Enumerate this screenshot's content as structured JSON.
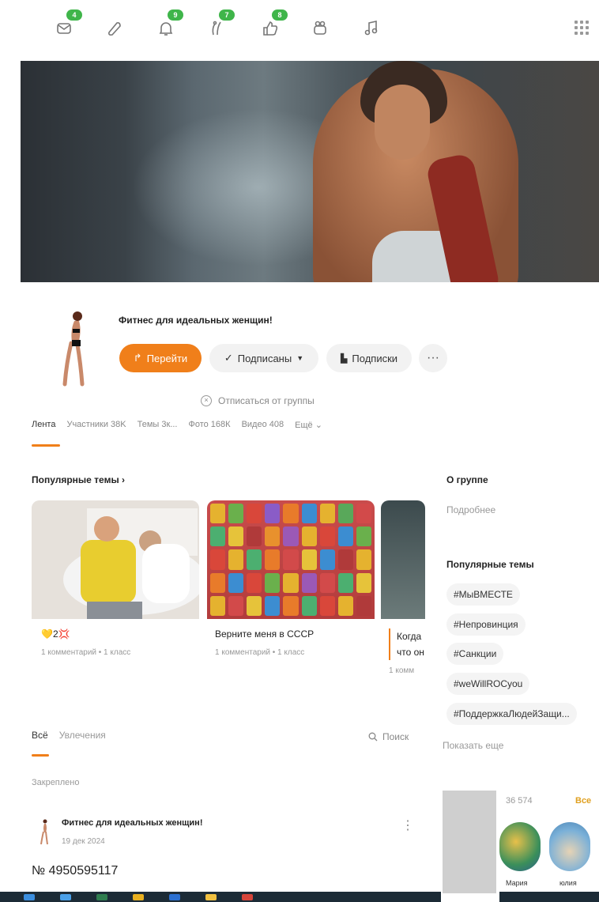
{
  "toolbar": {
    "icons": [
      {
        "name": "messages-icon",
        "badge": "4"
      },
      {
        "name": "discussions-icon",
        "badge": ""
      },
      {
        "name": "notifications-icon",
        "badge": "9"
      },
      {
        "name": "guests-icon",
        "badge": "7"
      },
      {
        "name": "events-icon",
        "badge": "8"
      },
      {
        "name": "video-icon",
        "badge": ""
      },
      {
        "name": "music-icon",
        "badge": ""
      }
    ],
    "apps_icon": "grid-icon"
  },
  "group": {
    "title": "Фитнес для идеальных женщин!",
    "go_label": "Перейти",
    "subscribed_label": "Подписаны",
    "subscriptions_label": "Подписки",
    "more_label": "···",
    "unsubscribe_label": "Отписаться от группы"
  },
  "tabs": {
    "items": [
      "Лента",
      "Участники 38K",
      "Темы 3к...",
      "Фото 168К",
      "Видео 408",
      "Ещё"
    ]
  },
  "popular": {
    "title": "Популярные темы",
    "cards": [
      {
        "caption": "💛2💢",
        "meta": "1 комментарий • 1 класс"
      },
      {
        "caption": "Верните меня в СССР",
        "meta": "1 комментарий • 1 класс"
      },
      {
        "caption": "Когда что он",
        "meta": "1 комм"
      }
    ]
  },
  "side": {
    "about_title": "О группе",
    "more_link": "Подробнее",
    "popular_title": "Популярные темы",
    "tags": [
      "#МыВМЕСТЕ",
      "#Непровинция",
      "#Санкции",
      "#weWillROCyou",
      "#ПоддержкаЛюдейЗащи..."
    ],
    "show_more": "Показать еще"
  },
  "feed": {
    "tab_all": "Всё",
    "tab_hobbies": "Увлечения",
    "search_label": "Поиск",
    "pinned_label": "Закреплено",
    "post_author": "Фитнес для идеальных женщин!",
    "post_date": "19 дек 2024",
    "post_menu": "⋮",
    "post_text": "№ 4950595117"
  },
  "members": {
    "count": "36 574",
    "all_label": "Все",
    "names": [
      "Мария",
      "юлия"
    ]
  },
  "colors": {
    "accent": "#f07f1a",
    "badge": "#3fb54a"
  }
}
